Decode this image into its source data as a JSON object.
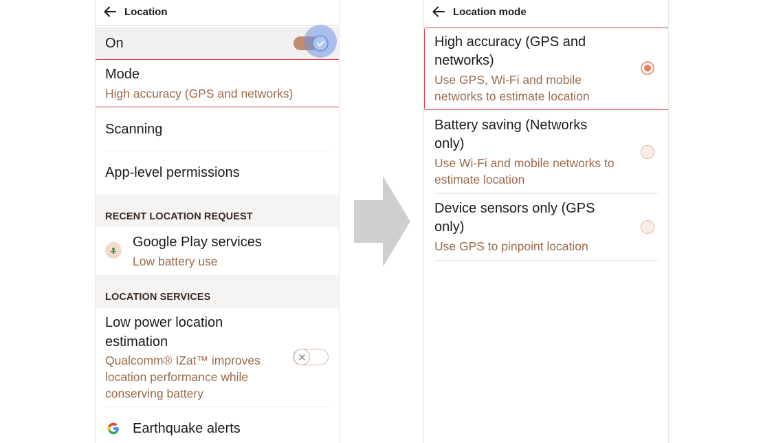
{
  "left_screen": {
    "title": "Location",
    "master_toggle": {
      "label": "On",
      "state": "on"
    },
    "mode": {
      "title": "Mode",
      "value": "High accuracy (GPS and networks)"
    },
    "scanning": {
      "label": "Scanning"
    },
    "app_level": {
      "label": "App-level permissions"
    },
    "recent_header": "RECENT LOCATION REQUEST",
    "recent_app": {
      "name": "Google Play services",
      "sub": "Low battery use"
    },
    "services_header": "LOCATION SERVICES",
    "low_power": {
      "title_line1": "Low power location",
      "title_line2": "estimation",
      "desc_line1": "Qualcomm® IZat™ improves",
      "desc_line2": "location performance while",
      "desc_line3": "conserving battery",
      "state": "off"
    },
    "earthquake": {
      "label": "Earthquake alerts"
    }
  },
  "right_screen": {
    "title": "Location mode",
    "options": [
      {
        "title_line1": "High accuracy (GPS and",
        "title_line2": "networks)",
        "desc_line1": "Use GPS, Wi-Fi and mobile",
        "desc_line2": "networks to estimate location",
        "selected": true
      },
      {
        "title_line1": "Battery saving (Networks",
        "title_line2": "only)",
        "desc_line1": "Use Wi-Fi and mobile networks to",
        "desc_line2": "estimate location",
        "selected": false
      },
      {
        "title_line1": "Device sensors only (GPS",
        "title_line2": "only)",
        "desc_line1": "Use GPS to pinpoint location",
        "selected": false
      }
    ]
  },
  "colors": {
    "accent_brown": "#9a6a4a",
    "highlight_red": "#d9404a",
    "arrow_gray": "#cfcfcf",
    "toggle_on_track": "#c48b73",
    "radio_dot": "#ee7d5d"
  },
  "icons": {
    "back": "back-arrow-icon",
    "check": "check-icon",
    "cross": "x-icon",
    "play_services": "google-play-services-icon",
    "google": "google-g-icon",
    "transition": "right-arrow-icon"
  }
}
